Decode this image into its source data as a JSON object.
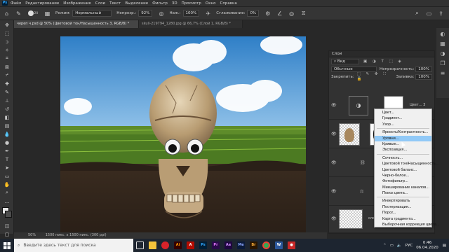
{
  "menubar": {
    "logo": "Ps",
    "items": [
      "Файл",
      "Редактирование",
      "Изображение",
      "Слои",
      "Текст",
      "Выделение",
      "Фильтр",
      "3D",
      "Просмотр",
      "Окно",
      "Справка"
    ]
  },
  "options": {
    "mode_label": "Режим:",
    "mode_value": "Нормальный",
    "opacity_label": "Непрозр.:",
    "opacity_value": "92%",
    "pressure_label": "Наж.:",
    "pressure_value": "100%",
    "smoothing_label": "Сглаживание:",
    "smoothing_value": "0%",
    "brush_size": "20"
  },
  "tabs": [
    "череп ч.psd @ 50% (Цветовой тон/Насыщенность 3, RGB/8) *",
    "skull-219794_1280.jpg @ 66,7% (Слой 1, RGB/8) *"
  ],
  "status": {
    "zoom": "50%",
    "doc_size": "1500 пикс. x 1500 пикс. (300 ppi)"
  },
  "layers_panel": {
    "title": "Слои",
    "filter": "Вид",
    "blend_mode": "Обычные",
    "opacity_label": "Непрозрачность:",
    "opacity_value": "100%",
    "fill_label": "Заливка:",
    "fill_value": "100%",
    "lock_label": "Закрепить:",
    "layer1_name": "Цвет... 3",
    "layer5_name": "слой"
  },
  "context_menu": {
    "highlighted": "Уровни...",
    "groups": [
      [
        "Цвет...",
        "Градиент...",
        "Узор..."
      ],
      [
        "Яркость/Контрастность...",
        "Уровни...",
        "Кривые...",
        "Экспозиция..."
      ],
      [
        "Сочность...",
        "Цветовой тон/Насыщенность...",
        "Цветовой баланс...",
        "Черно-белое...",
        "Фотофильтр...",
        "Микширование каналов...",
        "Поиск цвета..."
      ],
      [
        "Инвертировать",
        "Постеризация...",
        "Порог...",
        "Карта градиента...",
        "Выборочная коррекция цвета..."
      ]
    ]
  },
  "taskbar": {
    "search_placeholder": "Введите здесь текст для поиска",
    "language": "РУС",
    "time": "0:46",
    "date": "06.04.2020"
  },
  "colors": {
    "accent": "#31a8ff",
    "menu_highlight": "#91c9f7",
    "taskbar": "#1d2530"
  }
}
